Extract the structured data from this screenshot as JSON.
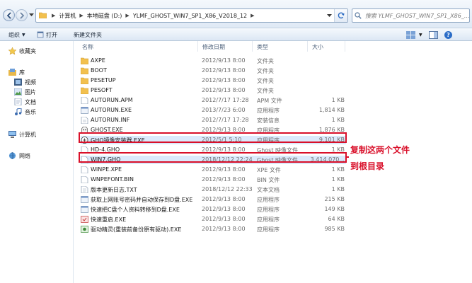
{
  "address": {
    "crumbs": [
      "计算机",
      "本地磁盘 (D:)",
      "YLMF_GHOST_WIN7_SP1_X86_V2018_12"
    ],
    "search_placeholder": "搜索 YLMF_GHOST_WIN7_SP1_X86_..."
  },
  "toolbar": {
    "organize": "组织",
    "open": "打开",
    "new_folder": "新建文件夹"
  },
  "nav": {
    "favorites": "收藏夹",
    "library": "库",
    "videos": "视频",
    "pictures": "图片",
    "documents": "文档",
    "music": "音乐",
    "computer": "计算机",
    "network": "网络"
  },
  "columns": {
    "name": "名称",
    "date": "修改日期",
    "type": "类型",
    "size": "大小"
  },
  "files": [
    {
      "name": "AXPE",
      "date": "2012/9/13 8:00",
      "type": "文件夹",
      "size": "",
      "icon": "folder-icon"
    },
    {
      "name": "BOOT",
      "date": "2012/9/13 8:00",
      "type": "文件夹",
      "size": "",
      "icon": "folder-icon"
    },
    {
      "name": "PESETUP",
      "date": "2012/9/13 8:00",
      "type": "文件夹",
      "size": "",
      "icon": "folder-icon"
    },
    {
      "name": "PESOFT",
      "date": "2012/9/13 8:00",
      "type": "文件夹",
      "size": "",
      "icon": "folder-icon"
    },
    {
      "name": "AUTORUN.APM",
      "date": "2012/7/17 17:28",
      "type": "APM 文件",
      "size": "1 KB",
      "icon": "file-icon"
    },
    {
      "name": "AUTORUN.EXE",
      "date": "2013/7/23 6:00",
      "type": "应用程序",
      "size": "1,814 KB",
      "icon": "exe-icon"
    },
    {
      "name": "AUTORUN.INF",
      "date": "2012/7/17 17:28",
      "type": "安装信息",
      "size": "1 KB",
      "icon": "inf-icon"
    },
    {
      "name": "GHOST.EXE",
      "date": "2012/9/13 8:00",
      "type": "应用程序",
      "size": "1,876 KB",
      "icon": "ghost-icon"
    },
    {
      "name": "GHO镜像安装器.EXE",
      "date": "2012/5/1 5:10",
      "type": "应用程序",
      "size": "9,101 KB",
      "icon": "installer-icon"
    },
    {
      "name": "HD-4.GHO",
      "date": "2012/9/13 8:00",
      "type": "Ghost 映像文件",
      "size": "1 KB",
      "icon": "file-icon"
    },
    {
      "name": "WIN7.GHO",
      "date": "2018/12/12 22:24",
      "type": "Ghost 映像文件",
      "size": "3,414,070...",
      "icon": "file-icon"
    },
    {
      "name": "WINPE.XPE",
      "date": "2012/9/13 8:00",
      "type": "XPE 文件",
      "size": "1 KB",
      "icon": "file-icon"
    },
    {
      "name": "WNPEFONT.BIN",
      "date": "2012/9/13 8:00",
      "type": "BIN 文件",
      "size": "1 KB",
      "icon": "file-icon"
    },
    {
      "name": "版本更新日志.TXT",
      "date": "2018/12/12 22:33",
      "type": "文本文档",
      "size": "1 KB",
      "icon": "txt-icon"
    },
    {
      "name": "获取上网账号密码并自动保存到D盘.EXE",
      "date": "2012/9/13 8:00",
      "type": "应用程序",
      "size": "215 KB",
      "icon": "exe-icon"
    },
    {
      "name": "快速把C盘个人资料转移到D盘.EXE",
      "date": "2012/9/13 8:00",
      "type": "应用程序",
      "size": "149 KB",
      "icon": "exe-icon"
    },
    {
      "name": "快速重启.EXE",
      "date": "2012/9/13 8:00",
      "type": "应用程序",
      "size": "64 KB",
      "icon": "restart-icon"
    },
    {
      "name": "驱动精灵(重装前备份原有驱动).EXE",
      "date": "2012/9/13 8:00",
      "type": "应用程序",
      "size": "985 KB",
      "icon": "driver-icon"
    }
  ],
  "annotation": {
    "line1": "复制这两个文件",
    "line2": "到根目录"
  },
  "colors": {
    "highlight": "#d9102a",
    "selection": "#dbe9fb",
    "folder": "#f2c04e"
  }
}
